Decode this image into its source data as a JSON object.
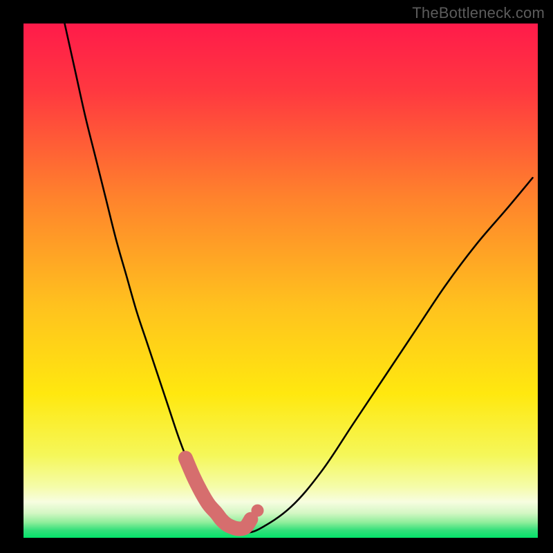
{
  "watermark": "TheBottleneck.com",
  "chart_data": {
    "type": "line",
    "title": "",
    "xlabel": "",
    "ylabel": "",
    "xlim": [
      0,
      100
    ],
    "ylim": [
      0,
      100
    ],
    "grid": false,
    "legend": false,
    "background_gradient": {
      "top_color": "#ff1b4a",
      "mid_color": "#ffe800",
      "bottom_color": "#04e36a"
    },
    "series": [
      {
        "name": "bottleneck-curve",
        "type": "line",
        "stroke": "#000000",
        "x": [
          8,
          10,
          12,
          14,
          16,
          18,
          20,
          22,
          24,
          26,
          28,
          30,
          31.5,
          33,
          34.5,
          36,
          37.5,
          38.5,
          40,
          41.5,
          43,
          46,
          52,
          58,
          64,
          70,
          76,
          82,
          88,
          94,
          99
        ],
        "values": [
          100,
          91,
          82,
          74,
          66,
          58,
          51,
          44,
          38,
          32,
          26,
          20,
          16,
          12.5,
          9.5,
          7,
          5,
          3.5,
          2.2,
          1.4,
          1,
          1.8,
          6,
          13,
          22,
          31,
          40,
          49,
          57,
          64,
          70
        ]
      },
      {
        "name": "optimal-zone-marker",
        "type": "line",
        "stroke": "#d66e6e",
        "x": [
          31.5,
          33,
          34.5,
          36,
          37.5,
          38.5,
          39.5,
          40.5,
          41.5,
          42.5,
          43.3,
          44.2
        ],
        "values": [
          15.5,
          12,
          9,
          6.5,
          4.8,
          3.5,
          2.6,
          2.1,
          1.8,
          1.8,
          2.2,
          3.6
        ]
      },
      {
        "name": "end-dot",
        "type": "scatter",
        "stroke": "#d66e6e",
        "x": [
          45.5
        ],
        "values": [
          5.3
        ]
      }
    ]
  }
}
